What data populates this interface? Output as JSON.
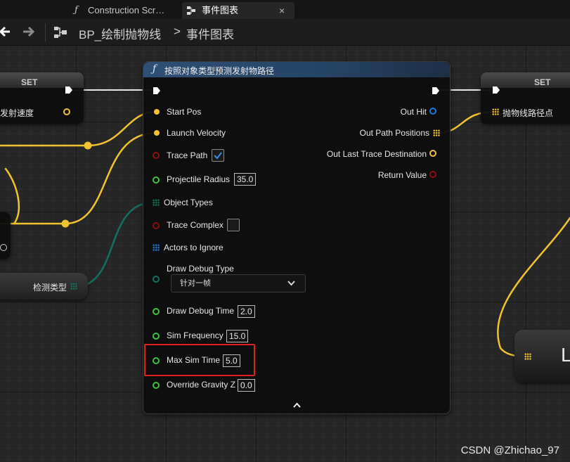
{
  "tabs": [
    {
      "label": "Construction Scr…",
      "icon": "function-icon",
      "active": false
    },
    {
      "label": "事件图表",
      "icon": "graph-icon",
      "active": true,
      "close": "×"
    }
  ],
  "breadcrumb": {
    "blueprint": "BP_绘制抛物线",
    "separator": ">",
    "graph": "事件图表"
  },
  "left_set_node": {
    "title": "SET",
    "pin_label": "发射速度"
  },
  "detect_node": {
    "label": "检测类型"
  },
  "right_set_node": {
    "title": "SET",
    "pin_label": "抛物线路径点"
  },
  "partial_node": {
    "text": "L"
  },
  "main_node": {
    "title": "按照对象类型预测发射物路径",
    "inputs": {
      "start_pos": "Start Pos",
      "launch_velocity": "Launch Velocity",
      "trace_path": "Trace Path",
      "projectile_radius": "Projectile Radius",
      "projectile_radius_value": "35.0",
      "object_types": "Object Types",
      "trace_complex": "Trace Complex",
      "actors_to_ignore": "Actors to Ignore",
      "draw_debug_type": "Draw Debug Type",
      "draw_debug_type_value": "针对一帧",
      "draw_debug_time": "Draw Debug Time",
      "draw_debug_time_value": "2.0",
      "sim_frequency": "Sim Frequency",
      "sim_frequency_value": "15.0",
      "max_sim_time": "Max Sim Time",
      "max_sim_time_value": "5.0",
      "override_gravity_z": "Override Gravity Z",
      "override_gravity_z_value": "0.0"
    },
    "trace_path_checked": true,
    "trace_complex_checked": false,
    "outputs": {
      "out_hit": "Out Hit",
      "out_path_positions": "Out Path Positions",
      "out_last_trace_destination": "Out Last Trace Destination",
      "return_value": "Return Value"
    },
    "collapse_icon": "chevron-up-icon"
  },
  "colors": {
    "vector_pin": "#f2c230",
    "bool_pin": "#8a1010",
    "float_pin": "#3ec33e",
    "struct_pin": "#1c7ad8",
    "object_type_pin": "#137060",
    "highlight": "#e0201a"
  },
  "watermark": "CSDN @Zhichao_97"
}
